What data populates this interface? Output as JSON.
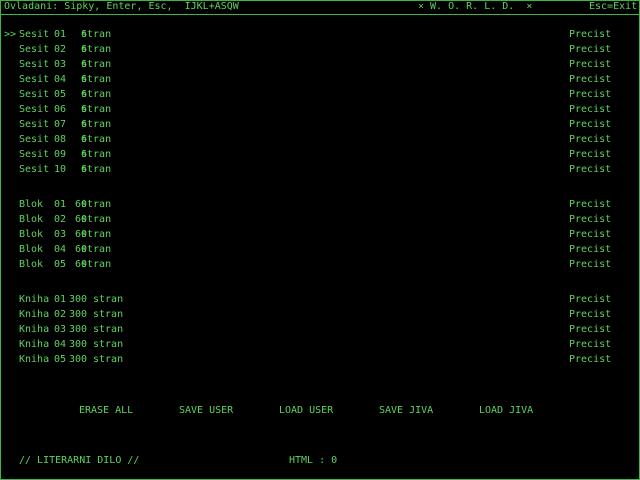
{
  "header": {
    "controls": "Ovladani: Sipky, Enter, Esc,  IJKL+ASQW",
    "title": "× W. O. R. L. D.  ×",
    "exit": "Esc=Exit"
  },
  "selector": ">>",
  "groups": {
    "sesit": [
      {
        "name": "Sesit",
        "num": "01",
        "pages": "6",
        "unit": "stran",
        "action": "Precist"
      },
      {
        "name": "Sesit",
        "num": "02",
        "pages": "6",
        "unit": "stran",
        "action": "Precist"
      },
      {
        "name": "Sesit",
        "num": "03",
        "pages": "6",
        "unit": "stran",
        "action": "Precist"
      },
      {
        "name": "Sesit",
        "num": "04",
        "pages": "6",
        "unit": "stran",
        "action": "Precist"
      },
      {
        "name": "Sesit",
        "num": "05",
        "pages": "6",
        "unit": "stran",
        "action": "Precist"
      },
      {
        "name": "Sesit",
        "num": "06",
        "pages": "6",
        "unit": "stran",
        "action": "Precist"
      },
      {
        "name": "Sesit",
        "num": "07",
        "pages": "6",
        "unit": "stran",
        "action": "Precist"
      },
      {
        "name": "Sesit",
        "num": "08",
        "pages": "6",
        "unit": "stran",
        "action": "Precist"
      },
      {
        "name": "Sesit",
        "num": "09",
        "pages": "6",
        "unit": "stran",
        "action": "Precist"
      },
      {
        "name": "Sesit",
        "num": "10",
        "pages": "6",
        "unit": "stran",
        "action": "Precist"
      }
    ],
    "blok": [
      {
        "name": "Blok",
        "num": "01",
        "pages": "60",
        "unit": "stran",
        "action": "Precist"
      },
      {
        "name": "Blok",
        "num": "02",
        "pages": "60",
        "unit": "stran",
        "action": "Precist"
      },
      {
        "name": "Blok",
        "num": "03",
        "pages": "60",
        "unit": "stran",
        "action": "Precist"
      },
      {
        "name": "Blok",
        "num": "04",
        "pages": "60",
        "unit": "stran",
        "action": "Precist"
      },
      {
        "name": "Blok",
        "num": "05",
        "pages": "60",
        "unit": "stran",
        "action": "Precist"
      }
    ],
    "kniha": [
      {
        "name": "Kniha",
        "num": "01",
        "pages": "300",
        "unit": "stran",
        "action": "Precist"
      },
      {
        "name": "Kniha",
        "num": "02",
        "pages": "300",
        "unit": "stran",
        "action": "Precist"
      },
      {
        "name": "Kniha",
        "num": "03",
        "pages": "300",
        "unit": "stran",
        "action": "Precist"
      },
      {
        "name": "Kniha",
        "num": "04",
        "pages": "300",
        "unit": "stran",
        "action": "Precist"
      },
      {
        "name": "Kniha",
        "num": "05",
        "pages": "300",
        "unit": "stran",
        "action": "Precist"
      }
    ]
  },
  "buttons": {
    "erase_all": "ERASE ALL",
    "save_user": "SAVE USER",
    "load_user": "LOAD USER",
    "save_jiva": "SAVE JIVA",
    "load_jiva": "LOAD JIVA"
  },
  "footer": {
    "label": "// LITERARNI DILO //",
    "html": "HTML : 0"
  },
  "colors": {
    "text": "#5fd35f",
    "border": "#3cb83c",
    "background": "#000000"
  }
}
